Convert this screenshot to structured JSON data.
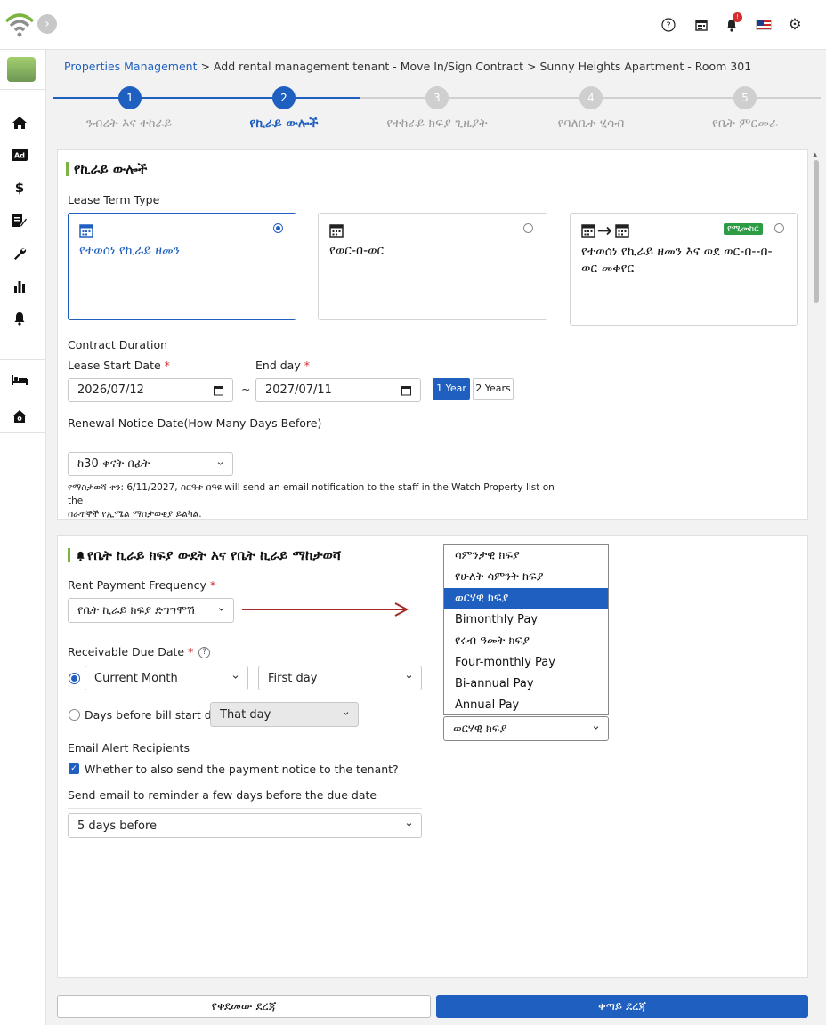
{
  "topbar": {
    "help_icon": "?",
    "calendar_icon": "▦",
    "notification_count": "!",
    "settings_icon": "⚙"
  },
  "breadcrumb": {
    "link": "Properties Management",
    "sep1": " > ",
    "item2": "Add rental management tenant - Move In/Sign Contract",
    "sep2": " > ",
    "item3": "Sunny Heights Apartment - Room 301"
  },
  "steps": [
    {
      "number": "1",
      "label": "ንብረት እና ተከራይ",
      "state": "done"
    },
    {
      "number": "2",
      "label": "የኪራይ ውሎች",
      "state": "active"
    },
    {
      "number": "3",
      "label": "የተከራይ ክፍያ ጊዜያት",
      "state": "pending"
    },
    {
      "number": "4",
      "label": "የባለቤቱ ሂሳብ",
      "state": "pending"
    },
    {
      "number": "5",
      "label": "የቤት ምርመራ",
      "state": "pending"
    }
  ],
  "lease": {
    "section_title": "የኪራይ ውሎች",
    "term_type_label": "Lease Term Type",
    "options": [
      {
        "text": "የተወሰነ የኪራይ ዘመን",
        "selected": true
      },
      {
        "text": "የወር-በ-ወር",
        "selected": false
      },
      {
        "text": "የተወሰነ የኪራይ ዘመን እና ወደ ወር-በ--በ-ወር መቀየር",
        "badge": "የሚመከር",
        "selected": false
      }
    ],
    "contract_duration_label": "Contract Duration",
    "start_label": "Lease Start Date",
    "start_value": "2026/07/12",
    "tilde": "~",
    "end_label": "End day",
    "end_value": "2027/07/11",
    "required_mark": "*",
    "btn_1year": "1 Year",
    "btn_2years": "2 Years",
    "renewal_label": "Renewal Notice Date(How Many Days Before)",
    "renewal_value": "ከ30 ቀናት በፊት",
    "note_line1": "የማስታወሻ ቀን: 6/11/2027, ስርዓቱ በዓዩ will send an email notification to the staff in the Watch Property list on the",
    "note_line2": "ሰራተኞች የኢሜል ማስታወቂያ ይልካል."
  },
  "rent": {
    "section_title": "የቤት ኪራይ ክፍያ ውደት እና የቤት ኪራይ ማከታወሻ",
    "freq_label": "Rent Payment Frequency",
    "freq_value": "የቤት ኪራይ ክፍያ ድግግሞሽ",
    "due_label": "Receivable Due Date",
    "help": "?",
    "month_value": "Current Month",
    "day_value": "First day",
    "days_before_label": "Days before bill start date:",
    "days_before_value": "That day",
    "email_recipients_label": "Email Alert Recipients",
    "send_tenant_label": "Whether to also send the payment notice to the tenant?",
    "send_reminder_label": "Send email to reminder a few days before the due date",
    "reminder_value": "5 days before",
    "dropdown_items": [
      "ሳምንታዊ ክፍያ",
      "የሁለት ሳምንት ክፍያ",
      "ወርሃዊ ክፍያ",
      "Bimonthly Pay",
      "የሩብ ዓመት ክፍያ",
      "Four-monthly Pay",
      "Bi-annual Pay",
      "Annual Pay"
    ],
    "dropdown_selected_index": 2,
    "dropdown_value": "ወርሃዊ ክፍያ"
  },
  "footer": {
    "prev": "የቀደመው ደረጃ",
    "next": "ቀጣይ ደረጃ"
  },
  "colors": {
    "primary": "#1f5fbf",
    "accent_green": "#7cb342",
    "badge_green": "#2e9c45",
    "required_red": "#d32f2f"
  }
}
